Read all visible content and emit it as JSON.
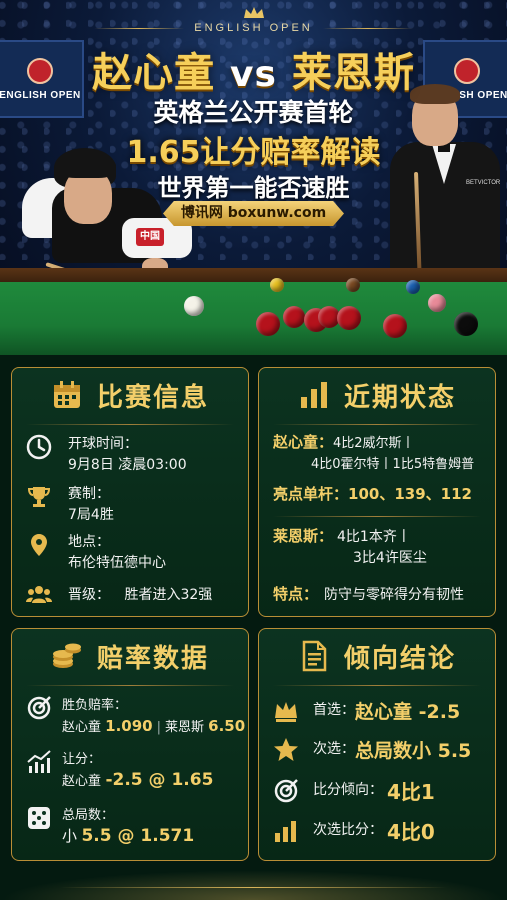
{
  "hero": {
    "event_tag": "ENGLISH OPEN",
    "banner_text": "ENGLISH OPEN",
    "player1": "赵心童",
    "vs": "vs",
    "player2": "莱恩斯",
    "sub1": "英格兰公开赛首轮",
    "sub2": "1.65让分赔率解读",
    "sub3": "世界第一能否速胜",
    "site": "博讯网 boxunw.com",
    "jersey_sponsor": "BETVICTOR",
    "sleeve_text": "中国"
  },
  "match_info": {
    "title": "比赛信息",
    "kickoff_label": "开球时间：",
    "kickoff_value": "9月8日 凌晨03:00",
    "format_label": "赛制：",
    "format_value": "7局4胜",
    "venue_label": "地点：",
    "venue_value": "布伦特伍德中心",
    "advance_label": "晋级：",
    "advance_value": "胜者进入32强"
  },
  "recent_form": {
    "title": "近期状态",
    "p1_name": "赵心童：",
    "p1_line1": "4比2威尔斯丨",
    "p1_line2": "4比0霍尔特丨1比5特鲁姆普",
    "highlight_label": "亮点单杆：",
    "highlight_value": "100、139、112",
    "p2_name": "莱恩斯：",
    "p2_line1": "4比1本齐丨",
    "p2_line2": "3比4许医尘",
    "trait_label": "特点：",
    "trait_value": "防守与零碎得分有韧性"
  },
  "odds": {
    "title": "赔率数据",
    "winlose_label": "胜负赔率：",
    "p1": "赵心童",
    "p1_odds": "1.090",
    "p2": "莱恩斯",
    "p2_odds": "6.50",
    "handicap_label": "让分：",
    "handicap_player": "赵心童",
    "handicap_value": "-2.5 @ 1.65",
    "total_label": "总局数：",
    "total_side": "小",
    "total_value": "5.5 @ 1.571"
  },
  "verdict": {
    "title": "倾向结论",
    "pick1_label": "首选：",
    "pick1_value": "赵心童 -2.5",
    "pick2_label": "次选：",
    "pick2_value": "总局数小 5.5",
    "score_label": "比分倾向：",
    "score_value": "4比1",
    "alt_score_label": "次选比分：",
    "alt_score_value": "4比0"
  },
  "colors": {
    "gold": "#f3cf6a",
    "card_bg": "#0c3320",
    "border": "#b98e36",
    "felt": "#1f8a3c"
  }
}
